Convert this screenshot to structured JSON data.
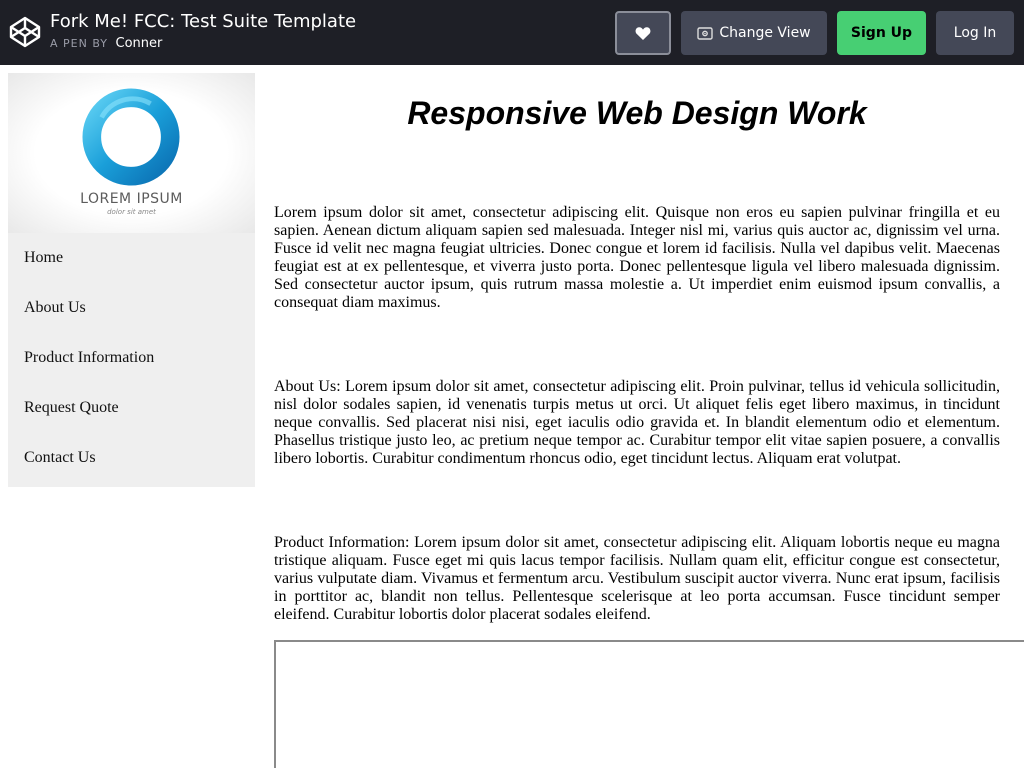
{
  "header": {
    "title": "Fork Me! FCC: Test Suite Template",
    "by_label": "A PEN BY",
    "author": "Conner",
    "heart_icon": "heart-icon",
    "change_view_label": "Change View",
    "signup_label": "Sign Up",
    "login_label": "Log In"
  },
  "sidebar": {
    "logo_text": "LOREM IPSUM",
    "logo_tagline": "dolor sit amet",
    "items": [
      {
        "label": "Home"
      },
      {
        "label": "About Us"
      },
      {
        "label": "Product Information"
      },
      {
        "label": "Request Quote"
      },
      {
        "label": "Contact Us"
      }
    ]
  },
  "main": {
    "heading": "Responsive Web Design Work",
    "paragraphs": [
      "Lorem ipsum dolor sit amet, consectetur adipiscing elit. Quisque non eros eu sapien pulvinar fringilla et eu sapien. Aenean dictum aliquam sapien sed malesuada. Integer nisl mi, varius quis auctor ac, dignissim vel urna. Fusce id velit nec magna feugiat ultricies. Donec congue et lorem id facilisis. Nulla vel dapibus velit. Maecenas feugiat est at ex pellentesque, et viverra justo porta. Donec pellentesque ligula vel libero malesuada dignissim. Sed consectetur auctor ipsum, quis rutrum massa molestie a. Ut imperdiet enim euismod ipsum convallis, a consequat diam maximus.",
      "About Us: Lorem ipsum dolor sit amet, consectetur adipiscing elit. Proin pulvinar, tellus id vehicula sollicitudin, nisl dolor sodales sapien, id venenatis turpis metus ut orci. Ut aliquet felis eget libero maximus, in tincidunt neque convallis. Sed placerat nisi nisi, eget iaculis odio gravida et. In blandit elementum odio et elementum. Phasellus tristique justo leo, ac pretium neque tempor ac. Curabitur tempor elit vitae sapien posuere, a convallis libero lobortis. Curabitur condimentum rhoncus odio, eget tincidunt lectus. Aliquam erat volutpat.",
      "Product Information: Lorem ipsum dolor sit amet, consectetur adipiscing elit. Aliquam lobortis neque eu magna tristique aliquam. Fusce eget mi quis lacus tempor facilisis. Nullam quam elit, efficitur congue est consectetur, varius vulputate diam. Vivamus et fermentum arcu. Vestibulum suscipit auctor viverra. Nunc erat ipsum, facilisis in porttitor ac, blandit non tellus. Pellentesque scelerisque at leo porta accumsan. Fusce tincidunt semper eleifend. Curabitur lobortis dolor placerat sodales eleifend."
    ]
  },
  "colors": {
    "topbar_bg": "#1e1f26",
    "button_bg": "#444857",
    "signup_bg": "#47cf73",
    "sidebar_bg": "#efefef",
    "logo_blue": "#1a9fd9"
  }
}
